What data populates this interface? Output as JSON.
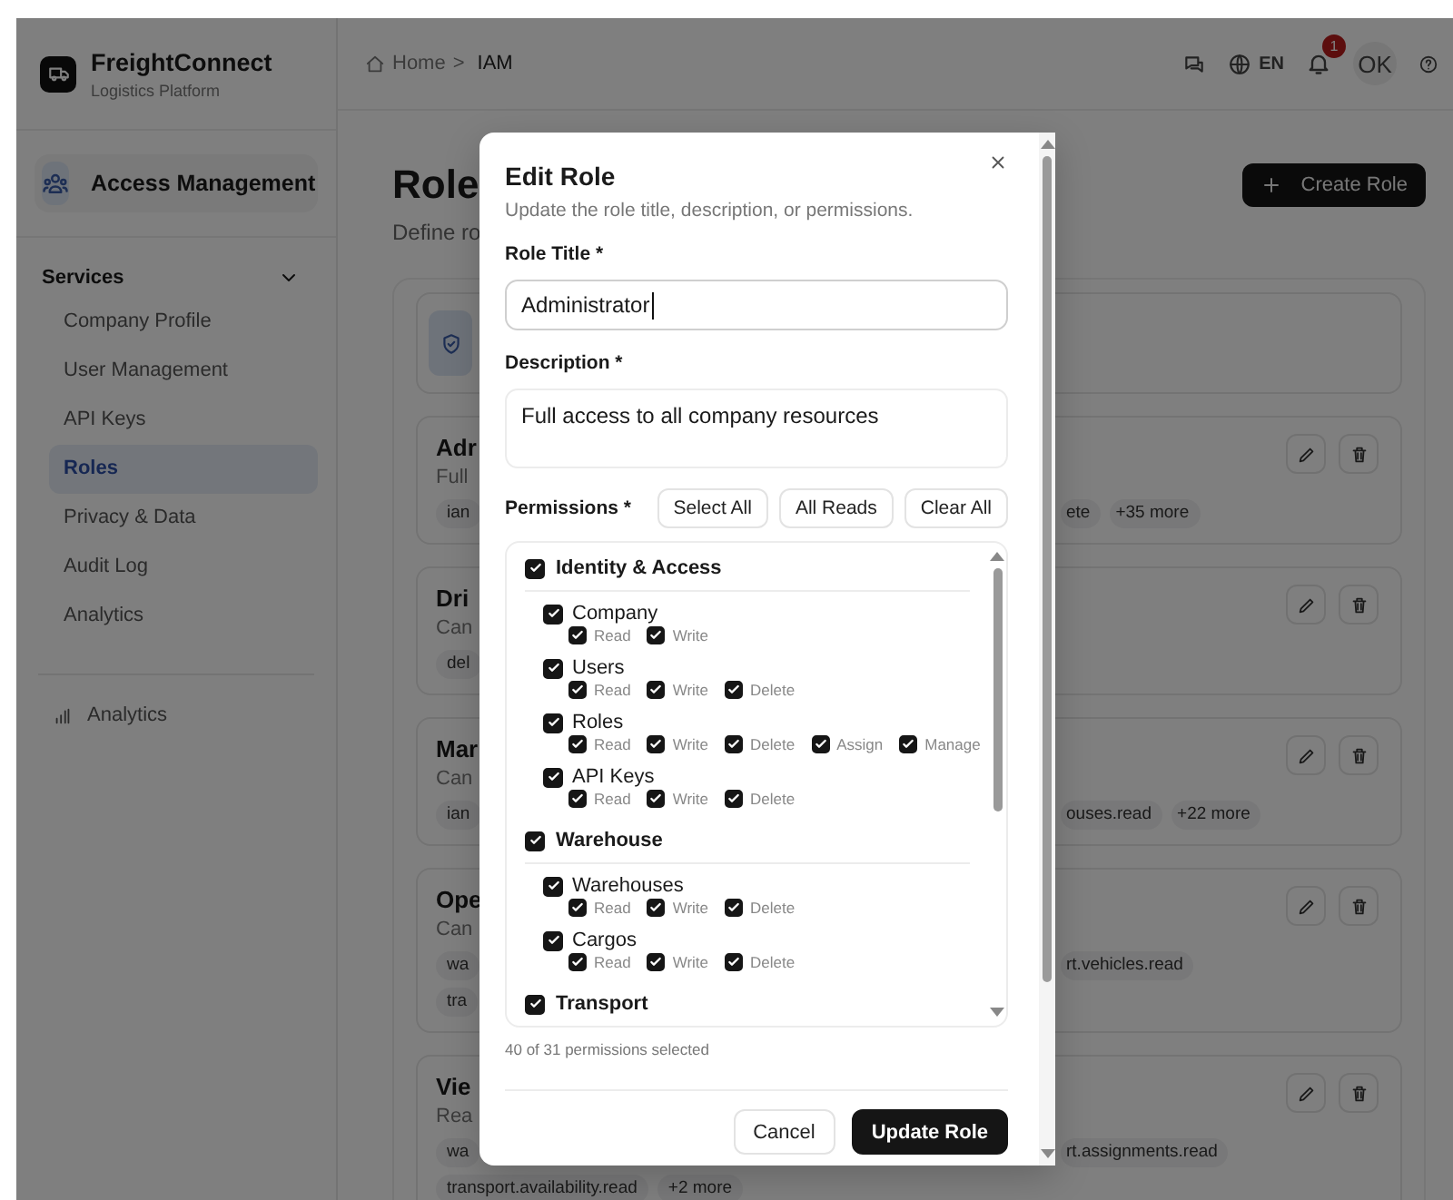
{
  "brand": {
    "name": "FreightConnect",
    "subtitle": "Logistics Platform"
  },
  "sidebar": {
    "module": "Access Management",
    "section": {
      "label": "Services",
      "expanded": true
    },
    "items": [
      {
        "label": "Company Profile",
        "selected": false
      },
      {
        "label": "User Management",
        "selected": false
      },
      {
        "label": "API Keys",
        "selected": false
      },
      {
        "label": "Roles",
        "selected": true
      },
      {
        "label": "Privacy & Data",
        "selected": false
      },
      {
        "label": "Audit Log",
        "selected": false
      },
      {
        "label": "Analytics",
        "selected": false
      }
    ],
    "footer_items": [
      {
        "label": "Analytics"
      }
    ]
  },
  "header": {
    "breadcrumb": [
      {
        "label": "Home"
      },
      {
        "label": "IAM"
      }
    ],
    "separator": ">",
    "language": "EN",
    "notification_count": "1",
    "avatar": "OK"
  },
  "page": {
    "title": "Role",
    "subtitle": "Define ro",
    "create_button": "Create Role"
  },
  "role_cards": [
    {
      "title": "Adr",
      "description": "Full",
      "tag_rows": [
        {
          "left": [
            "ian"
          ],
          "right": [
            "ete",
            "+35 more"
          ]
        }
      ]
    },
    {
      "title": "Dri",
      "description": "Can",
      "tag_rows": [
        {
          "left": [
            "del"
          ]
        }
      ]
    },
    {
      "title": "Mar",
      "description": "Can",
      "tag_rows": [
        {
          "left": [
            "ian"
          ],
          "right": [
            "ouses.read",
            "+22 more"
          ]
        }
      ]
    },
    {
      "title": "Ope",
      "description": "Can",
      "tag_rows": [
        {
          "left": [
            "wa"
          ],
          "right": [
            "rt.vehicles.read"
          ]
        },
        {
          "left": [
            "tra"
          ]
        }
      ]
    },
    {
      "title": "Vie",
      "description": "Rea",
      "tag_rows": [
        {
          "left": [
            "wa"
          ],
          "right": [
            "rt.assignments.read"
          ]
        },
        {
          "left": [
            "transport.availability.read",
            "+2 more"
          ]
        }
      ]
    }
  ],
  "dialog": {
    "title": "Edit Role",
    "subtitle": "Update the role title, description, or permissions.",
    "title_field": {
      "label": "Role Title *",
      "value": "Administrator"
    },
    "description_field": {
      "label": "Description *",
      "value": "Full access to all company resources"
    },
    "permissions": {
      "label": "Permissions *",
      "buttons": [
        "Select All",
        "All Reads",
        "Clear All"
      ],
      "groups": [
        {
          "label": "Identity & Access",
          "checked": true,
          "children": [
            {
              "label": "Company",
              "checked": true,
              "actions": [
                {
                  "label": "Read",
                  "checked": true
                },
                {
                  "label": "Write",
                  "checked": true
                }
              ]
            },
            {
              "label": "Users",
              "checked": true,
              "actions": [
                {
                  "label": "Read",
                  "checked": true
                },
                {
                  "label": "Write",
                  "checked": true
                },
                {
                  "label": "Delete",
                  "checked": true
                }
              ]
            },
            {
              "label": "Roles",
              "checked": true,
              "actions": [
                {
                  "label": "Read",
                  "checked": true
                },
                {
                  "label": "Write",
                  "checked": true
                },
                {
                  "label": "Delete",
                  "checked": true
                },
                {
                  "label": "Assign",
                  "checked": true
                },
                {
                  "label": "Manage",
                  "checked": true
                }
              ]
            },
            {
              "label": "API Keys",
              "checked": true,
              "actions": [
                {
                  "label": "Read",
                  "checked": true
                },
                {
                  "label": "Write",
                  "checked": true
                },
                {
                  "label": "Delete",
                  "checked": true
                }
              ]
            }
          ]
        },
        {
          "label": "Warehouse",
          "checked": true,
          "children": [
            {
              "label": "Warehouses",
              "checked": true,
              "actions": [
                {
                  "label": "Read",
                  "checked": true
                },
                {
                  "label": "Write",
                  "checked": true
                },
                {
                  "label": "Delete",
                  "checked": true
                }
              ]
            },
            {
              "label": "Cargos",
              "checked": true,
              "actions": [
                {
                  "label": "Read",
                  "checked": true
                },
                {
                  "label": "Write",
                  "checked": true
                },
                {
                  "label": "Delete",
                  "checked": true
                }
              ]
            }
          ]
        },
        {
          "label": "Transport",
          "checked": true
        }
      ],
      "summary": "40 of 31 permissions selected"
    },
    "buttons": [
      {
        "label": "Cancel",
        "kind": "secondary"
      },
      {
        "label": "Update Role",
        "kind": "primary"
      }
    ]
  }
}
